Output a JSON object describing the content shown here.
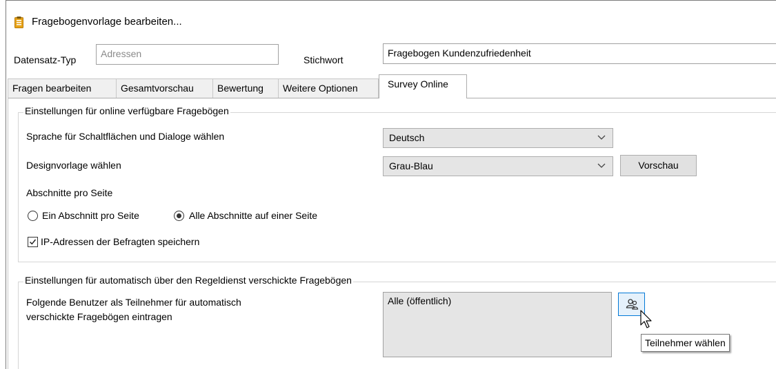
{
  "window": {
    "title": "Fragebogenvorlage bearbeiten...",
    "icon": "clipboard-icon",
    "accent": "#e8a317"
  },
  "form": {
    "record_type_label": "Datensatz-Typ",
    "record_type_value": "Adressen",
    "keyword_label": "Stichwort",
    "keyword_value": "Fragebogen Kundenzufriedenheit"
  },
  "tabs": [
    {
      "label": "Fragen bearbeiten",
      "active": false
    },
    {
      "label": "Gesamtvorschau",
      "active": false
    },
    {
      "label": "Bewertung",
      "active": false
    },
    {
      "label": "Weitere Optionen",
      "active": false
    },
    {
      "label": "Survey Online",
      "active": true
    }
  ],
  "online_group": {
    "title": "Einstellungen für online verfügbare Fragebögen",
    "language_label": "Sprache für Schaltflächen und Dialoge wählen",
    "language_value": "Deutsch",
    "design_label": "Designvorlage wählen",
    "design_value": "Grau-Blau",
    "preview_button": "Vorschau",
    "sections_label": "Abschnitte pro Seite",
    "radio_one_section": "Ein Abschnitt pro Seite",
    "radio_all_sections": "Alle Abschnitte auf einer Seite",
    "selected_radio": "Alle Abschnitte auf einer Seite",
    "ip_checkbox_label": "IP-Adressen der Befragten speichern",
    "ip_checkbox_checked": true
  },
  "auto_group": {
    "title": "Einstellungen für automatisch über den Regeldienst verschickte Fragebögen",
    "participants_label_line1": "Folgende Benutzer als Teilnehmer für automatisch",
    "participants_label_line2": "verschickte Fragebögen eintragen",
    "participants_value": "Alle (öffentlich)",
    "picker_icon": "users-icon",
    "tooltip": "Teilnehmer wählen"
  }
}
